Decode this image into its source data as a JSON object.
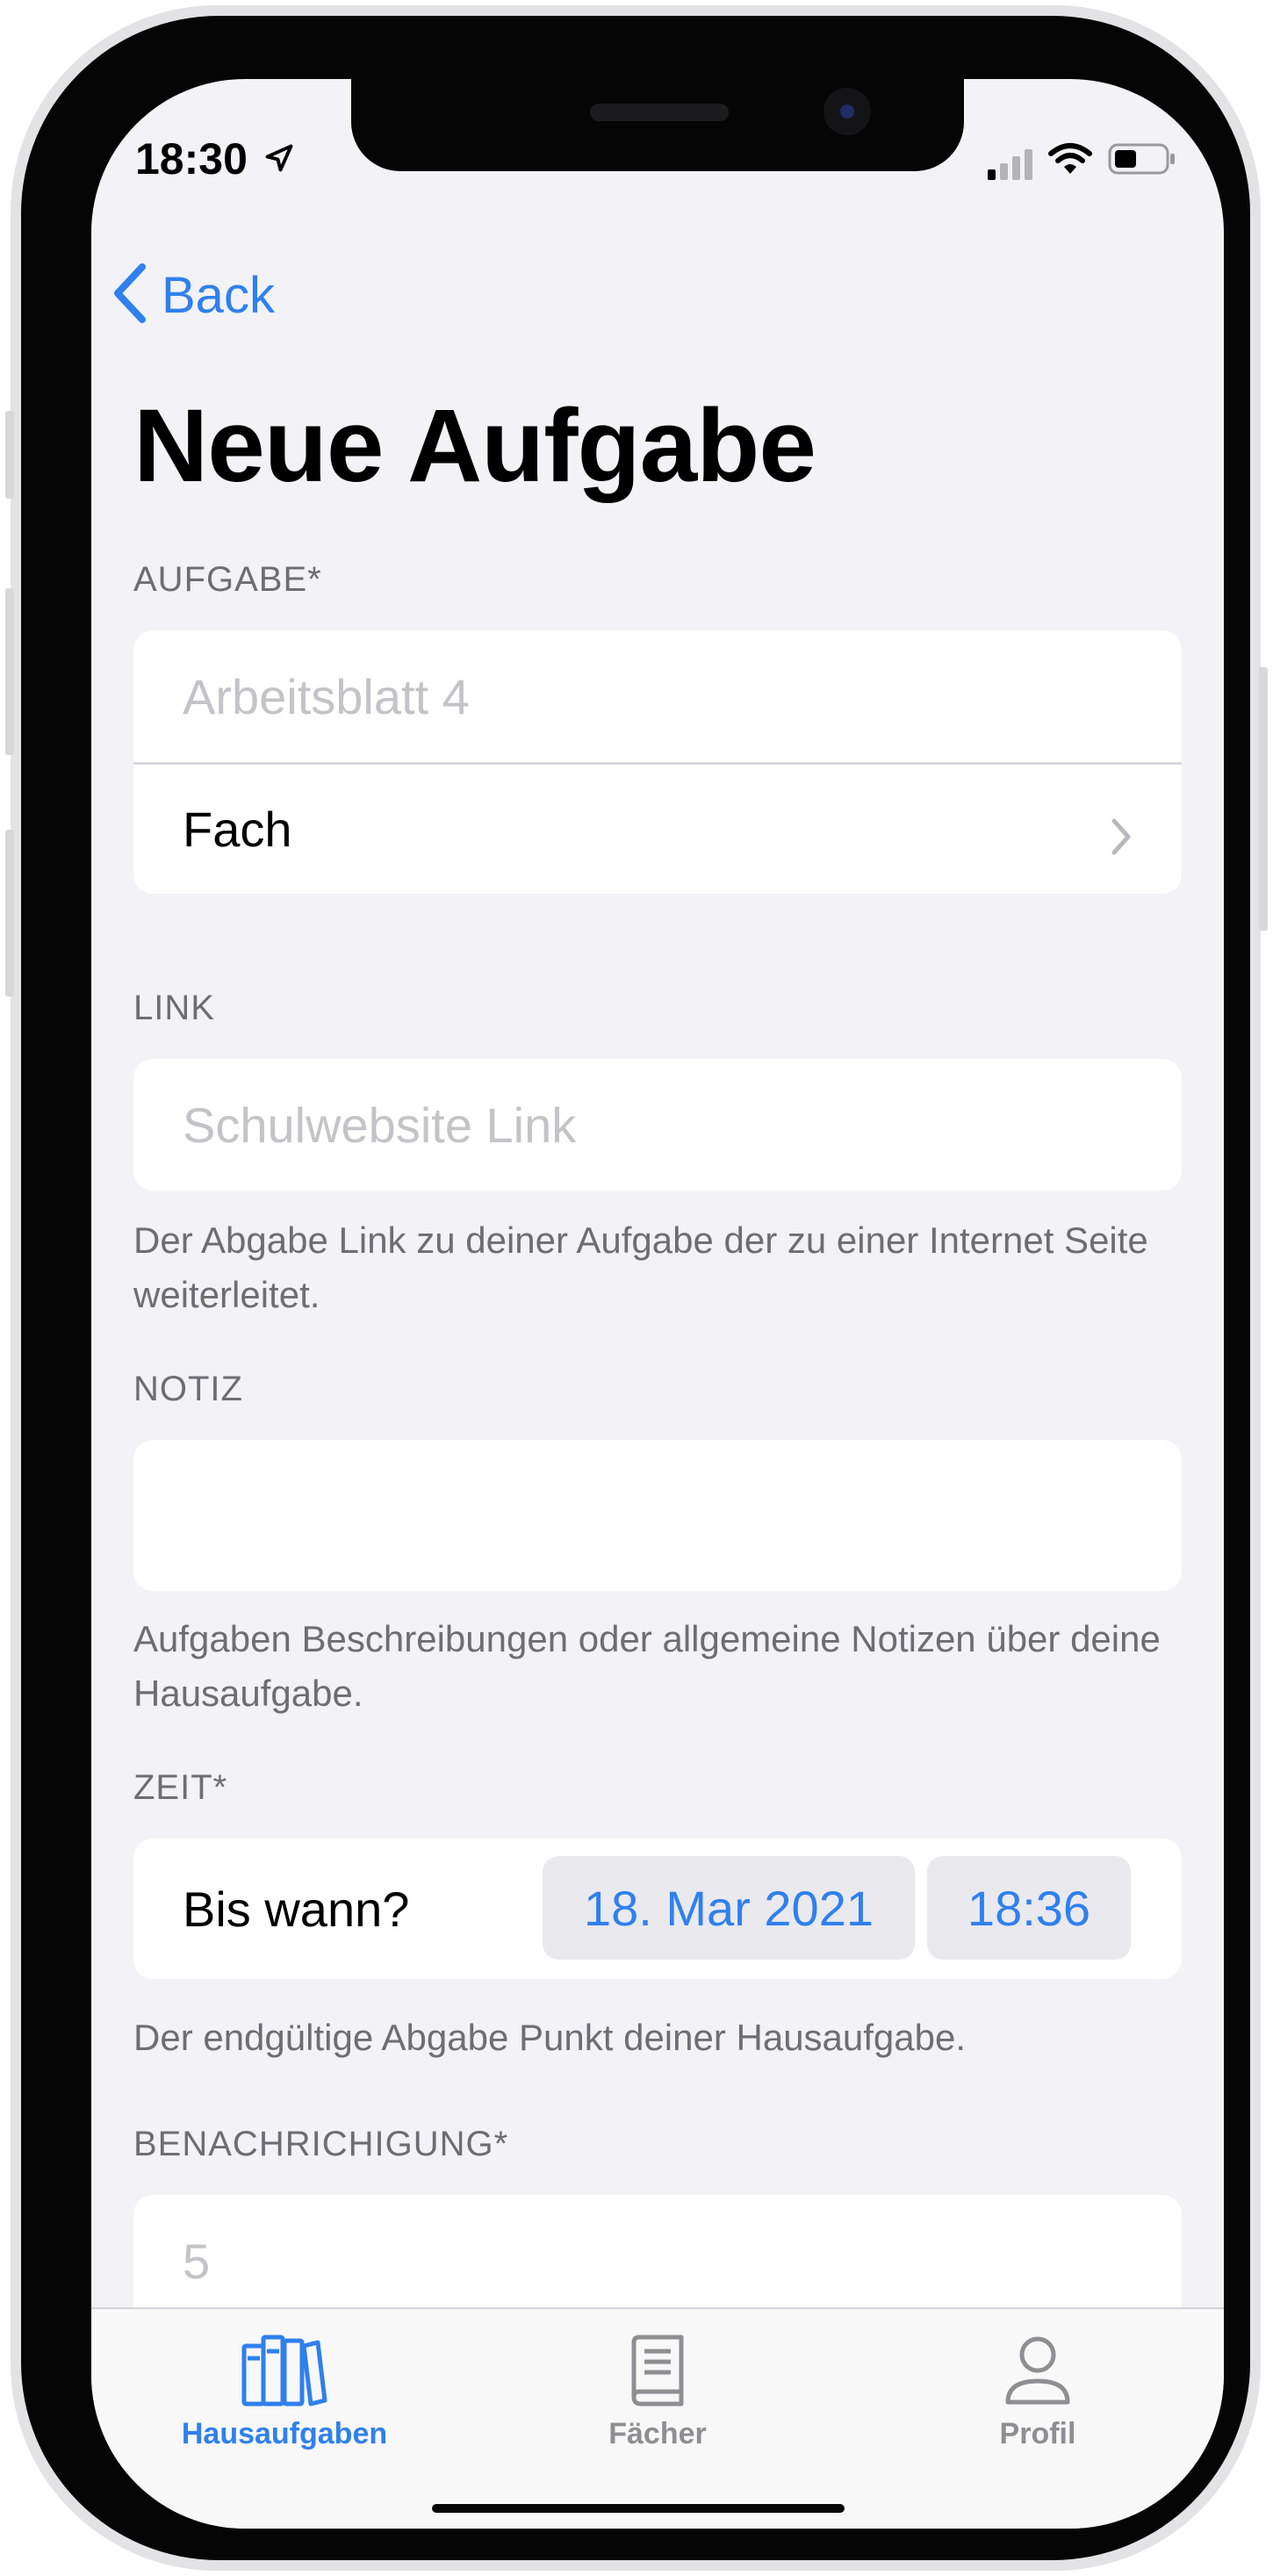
{
  "status_bar": {
    "time": "18:30",
    "location_icon": "location-arrow-icon",
    "signal_icon": "cellular-signal-icon",
    "wifi_icon": "wifi-icon",
    "battery_icon": "battery-icon"
  },
  "nav": {
    "back_label": "Back",
    "back_icon": "chevron-left-icon",
    "title": "Neue Aufgabe"
  },
  "colors": {
    "accent": "#2f80ed",
    "background": "#f2f2f7",
    "secondary_text": "#6d6d72",
    "placeholder": "#c3c3c8"
  },
  "form": {
    "aufgabe": {
      "header": "AUFGABE*",
      "title_placeholder": "Arbeitsblatt 4",
      "subject_label": "Fach"
    },
    "link": {
      "header": "LINK",
      "placeholder": "Schulwebsite Link",
      "footer": "Der Abgabe Link zu deiner Aufgabe der zu einer Internet Seite weiterleitet."
    },
    "notiz": {
      "header": "NOTIZ",
      "value": "",
      "footer": "Aufgaben Beschreibungen oder allgemeine Notizen über deine Hausaufgabe."
    },
    "zeit": {
      "header": "ZEIT*",
      "label": "Bis wann?",
      "date": "18. Mar 2021",
      "time": "18:36",
      "footer": "Der endgültige Abgabe Punkt deiner Hausaufgabe."
    },
    "benachrichtigung": {
      "header": "BENACHRICHIGUNG*",
      "placeholder": "5"
    }
  },
  "tabbar": {
    "tabs": [
      {
        "label": "Hausaufgaben",
        "icon": "books-icon",
        "active": true
      },
      {
        "label": "Fächer",
        "icon": "book-icon",
        "active": false
      },
      {
        "label": "Profil",
        "icon": "person-icon",
        "active": false
      }
    ]
  }
}
